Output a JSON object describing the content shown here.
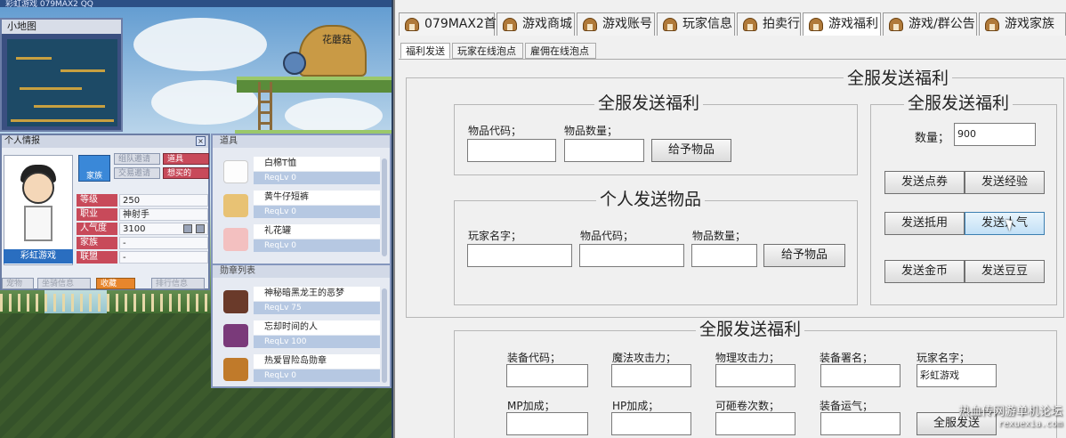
{
  "game": {
    "top_title": "彩虹游戏 079MAX2 QQ",
    "minimap_title": "小地图",
    "sign": "花蘑菇",
    "info_panel": {
      "title": "个人情报",
      "char_name": "彩虹游戏",
      "home_button": "家族",
      "buttons": [
        {
          "label": "组队邀请",
          "state": "disabled"
        },
        {
          "label": "道具",
          "state": "active"
        },
        {
          "label": "交易邀请",
          "state": "disabled"
        },
        {
          "label": "想买的",
          "state": "active"
        }
      ],
      "stats": [
        {
          "key": "等级",
          "value": "250"
        },
        {
          "key": "职业",
          "value": "神射手"
        },
        {
          "key": "人气度",
          "value": "3100"
        },
        {
          "key": "家族",
          "value": "-"
        },
        {
          "key": "联盟",
          "value": "-"
        }
      ],
      "bottom_buttons": [
        "宠物",
        "坐骑信息",
        "收藏",
        "排行信息"
      ]
    },
    "items_panel": {
      "title": "道具",
      "items": [
        {
          "name": "白棉T恤",
          "req": "ReqLv 0",
          "icon": "tshirt-icon"
        },
        {
          "name": "黄牛仔短裤",
          "req": "ReqLv 0",
          "icon": "shorts-icon"
        },
        {
          "name": "礼花罐",
          "req": "ReqLv 0",
          "icon": "firework-icon"
        }
      ]
    },
    "medals_panel": {
      "title": "勋章列表",
      "items": [
        {
          "name": "神秘暗黑龙王的恶梦",
          "req": "ReqLv 75",
          "icon": "medal-icon"
        },
        {
          "name": "忘却时间的人",
          "req": "ReqLv 100",
          "icon": "medal-icon"
        },
        {
          "name": "热爱冒险岛勋章",
          "req": "ReqLv 0",
          "icon": "medal-icon"
        }
      ]
    }
  },
  "app": {
    "tabs": [
      "079MAX2首页",
      "游戏商城",
      "游戏账号",
      "玩家信息",
      "拍卖行",
      "游戏福利",
      "游戏/群公告",
      "游戏家族"
    ],
    "subtabs": [
      "福利发送",
      "玩家在线泡点",
      "雇佣在线泡点"
    ],
    "outer_title": "全服发送福利",
    "left_top": {
      "title": "全服发送福利",
      "item_code_label": "物品代码；",
      "item_qty_label": "物品数量；",
      "item_code_value": "",
      "item_qty_value": "",
      "give_button": "给予物品"
    },
    "personal": {
      "title": "个人发送物品",
      "player_label": "玩家名字；",
      "item_code_label": "物品代码；",
      "item_qty_label": "物品数量；",
      "player_value": "",
      "item_code_value": "",
      "item_qty_value": "",
      "give_button": "给予物品"
    },
    "right": {
      "title": "全服发送福利",
      "qty_label": "数量；",
      "qty_value": "900",
      "buttons": [
        "发送点券",
        "发送经验",
        "发送抵用",
        "发送人气",
        "发送金币",
        "发送豆豆"
      ]
    },
    "equip": {
      "title": "全服发送福利",
      "labels_row1": [
        "装备代码；",
        "魔法攻击力；",
        "物理攻击力；",
        "装备署名；",
        "玩家名字；"
      ],
      "values_row1": [
        "",
        "",
        "",
        "",
        "彩虹游戏"
      ],
      "labels_row2": [
        "MP加成；",
        "HP加成；",
        "可砸卷次数；",
        "装备运气；"
      ],
      "values_row2": [
        "",
        "",
        "",
        ""
      ],
      "send_button": "全服发送"
    }
  },
  "watermark": {
    "line1": "热血传网游单机论坛",
    "line2": "rexuexia.com"
  }
}
